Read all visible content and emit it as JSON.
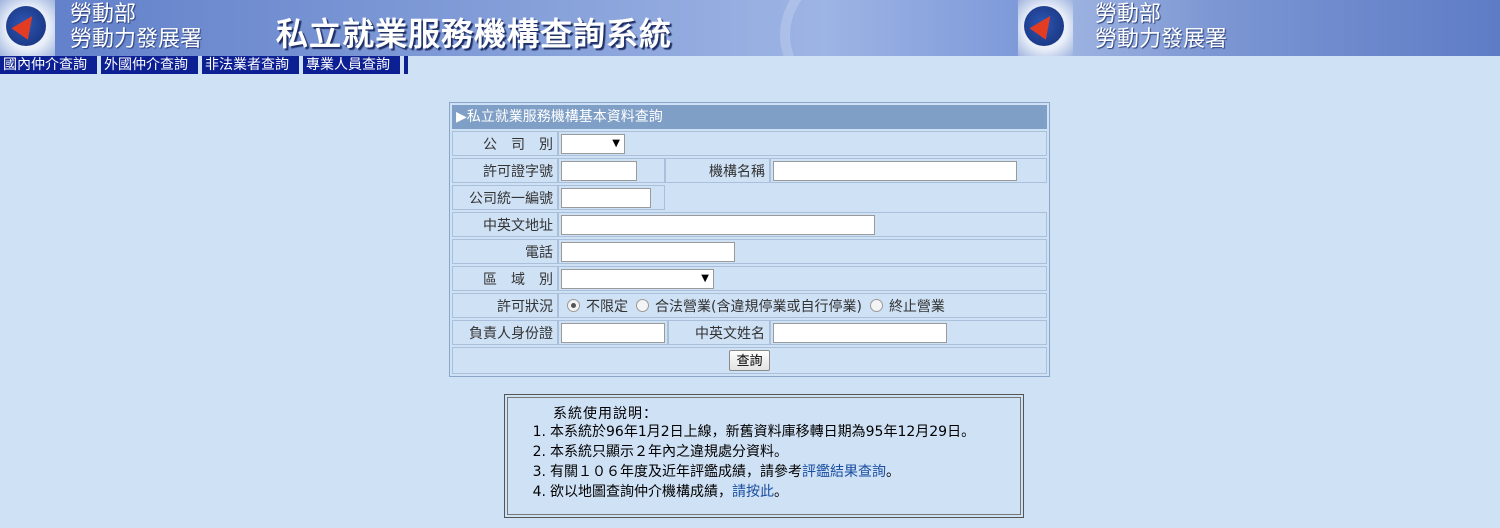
{
  "header": {
    "org_line1": "勞動部",
    "org_line2": "勞動力發展署",
    "system_title": "私立就業服務機構查詢系統",
    "logo_icon": "ministry-logo-icon"
  },
  "menu": {
    "items": [
      {
        "label": "國內仲介查詢"
      },
      {
        "label": "外國仲介查詢"
      },
      {
        "label": "非法業者查詢"
      },
      {
        "label": "專業人員查詢"
      }
    ]
  },
  "form": {
    "title": "▶私立就業服務機構基本資料查詢",
    "company_type_label": "公　司　別",
    "company_type_value": "",
    "license_no_label": "許可證字號",
    "license_no_value": "",
    "org_name_label": "機構名稱",
    "org_name_value": "",
    "ubn_label": "公司統一編號",
    "ubn_value": "",
    "address_label": "中英文地址",
    "address_value": "",
    "phone_label": "電話",
    "phone_value": "",
    "region_label": "區　域　別",
    "region_value": "",
    "status_label": "許可狀況",
    "status_options": [
      {
        "label": "不限定",
        "selected": true
      },
      {
        "label": "合法營業(含違規停業或自行停業)",
        "selected": false
      },
      {
        "label": "終止營業",
        "selected": false
      }
    ],
    "owner_id_label": "負責人身份證",
    "owner_id_value": "",
    "name_label": "中英文姓名",
    "name_value": "",
    "submit_label": "查詢"
  },
  "info": {
    "title": "系統使用說明：",
    "items": [
      {
        "num": "1.",
        "text": "本系統於96年1月2日上線，新舊資料庫移轉日期為95年12月29日。"
      },
      {
        "num": "2.",
        "text": "本系統只顯示２年內之違規處分資料。"
      },
      {
        "num": "3.",
        "text": "有關１０６年度及近年評鑑成績，請參考",
        "link": "評鑑結果查詢",
        "suffix": "。"
      },
      {
        "num": "4.",
        "text": "欲以地圖查詢仲介機構成績，",
        "link": "請按此",
        "suffix": "。"
      }
    ]
  }
}
